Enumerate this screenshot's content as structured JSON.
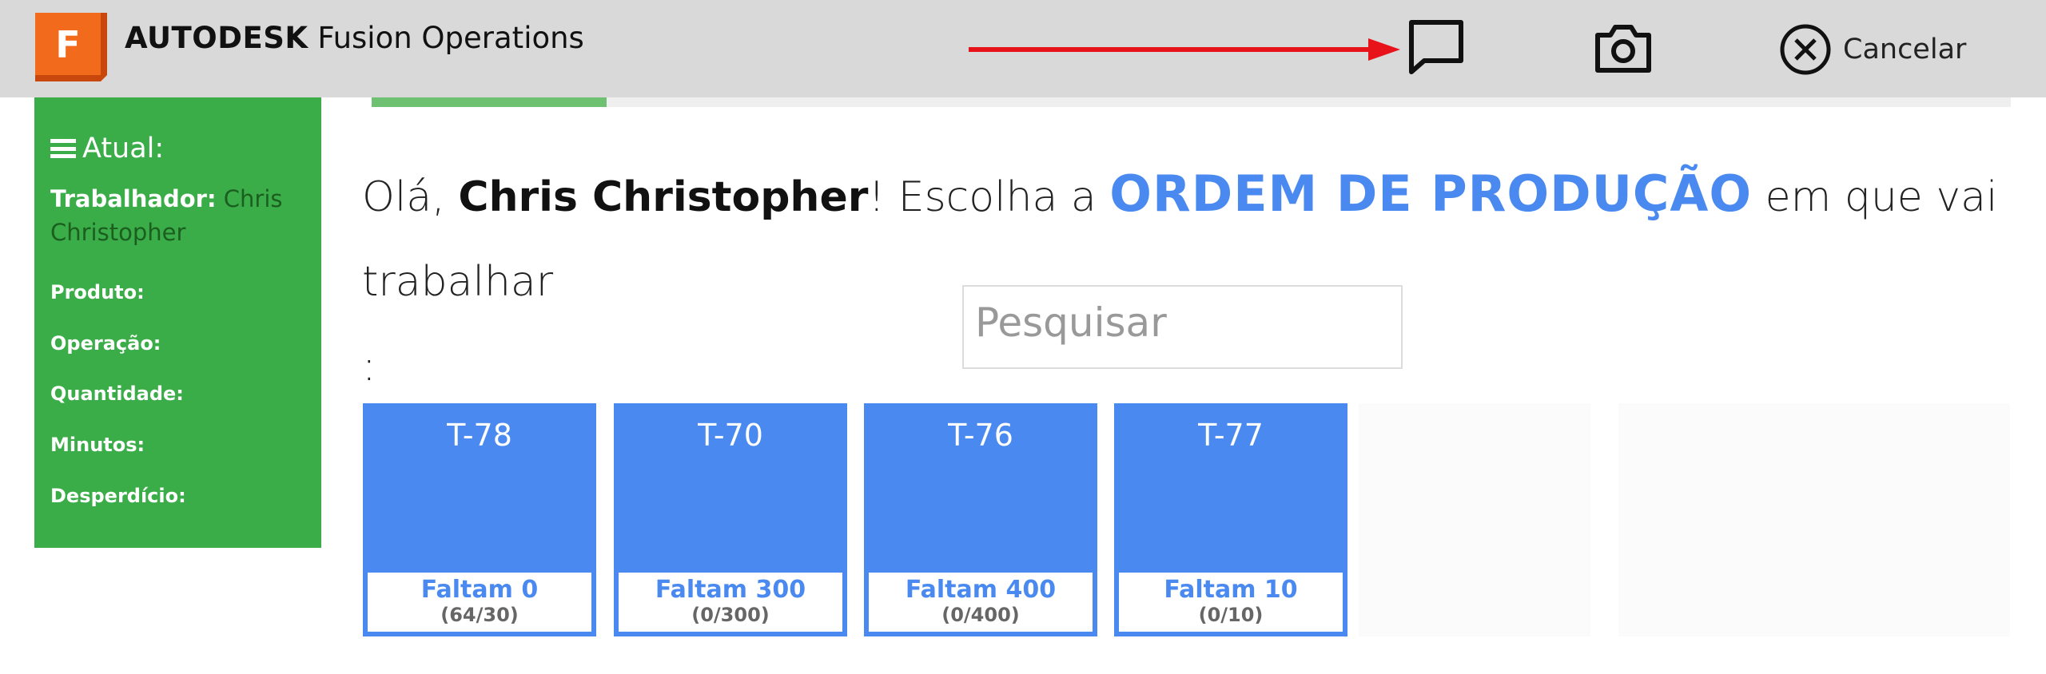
{
  "app": {
    "logo_letter": "F",
    "brand": "AUTODESK",
    "product": "Fusion Operations"
  },
  "toolbar": {
    "chat_icon": "chat-bubble-icon",
    "camera_icon": "camera-icon",
    "cancel_icon": "close-circle-icon",
    "cancel_label": "Cancelar",
    "arrow_color": "#e8131a"
  },
  "sidebar": {
    "title": "Atual:",
    "worker_label": "Trabalhador",
    "worker_value": "Chris Christopher",
    "fields": [
      "Produto:",
      "Operação:",
      "Quantidade:",
      "Minutos:",
      "Desperdício:"
    ]
  },
  "main": {
    "greeting_prefix": "Olá,",
    "user_name": "Chris Christopher",
    "greeting_mid": "! Escolha a",
    "ordem": "ORDEM DE PRODUÇÃO",
    "greeting_suffix": "em que vai trabalhar",
    "colon": ":",
    "search_placeholder": "Pesquisar"
  },
  "orders": [
    {
      "code": "T-78",
      "faltam": "Faltam 0",
      "count": "(64/30)"
    },
    {
      "code": "T-70",
      "faltam": "Faltam 300",
      "count": "(0/300)"
    },
    {
      "code": "T-76",
      "faltam": "Faltam 400",
      "count": "(0/400)"
    },
    {
      "code": "T-77",
      "faltam": "Faltam 10",
      "count": "(0/10)"
    }
  ],
  "colors": {
    "topbar": "#d9d9d9",
    "sidebar": "#3aad48",
    "accent": "#4a8af0",
    "logo": "#f26a1b"
  }
}
